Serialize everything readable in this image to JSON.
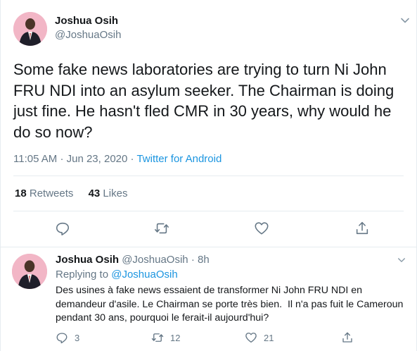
{
  "main_tweet": {
    "author_name": "Joshua Osih",
    "author_handle": "@JoshuaOsih",
    "text": "Some fake news laboratories are trying to turn Ni John FRU NDI into an asylum seeker. The Chairman is doing just fine. He hasn't fled CMR in 30 years, why would he do so now?",
    "time": "11:05 AM",
    "date": "Jun 23, 2020",
    "dot": "·",
    "source": "Twitter for Android",
    "retweets_count": "18",
    "retweets_label": "Retweets",
    "likes_count": "43",
    "likes_label": "Likes",
    "icons": [
      "reply-icon",
      "retweet-icon",
      "like-icon",
      "share-icon",
      "chevron-down-icon"
    ]
  },
  "reply_tweet": {
    "author_name": "Joshua Osih",
    "author_handle": "@JoshuaOsih",
    "dot": "·",
    "age": "8h",
    "replying_prefix": "Replying to",
    "replying_to": "@JoshuaOsih",
    "text": "Des usines à fake news essaient de transformer Ni John FRU NDI en demandeur d'asile. Le Chairman se porte très bien.  Il n'a pas fuit le Cameroun pendant 30 ans, pourquoi le ferait-il aujourd'hui?",
    "reply_count": "3",
    "retweet_count": "12",
    "like_count": "21"
  },
  "colors": {
    "link": "#1b95e0",
    "muted": "#657786",
    "text": "#14171a",
    "divider": "#e6ecf0"
  }
}
